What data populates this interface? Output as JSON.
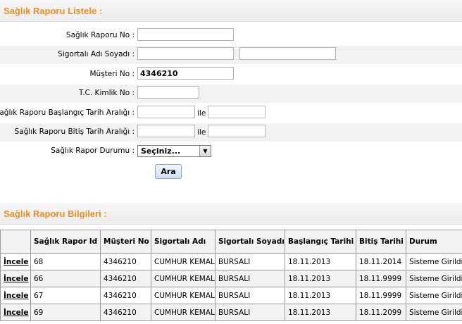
{
  "search_section": {
    "title": "Sağlık Raporu Listele :",
    "fields": {
      "report_no_label": "Sağlık Raporu No :",
      "report_no_value": "",
      "insured_name_label": "Sigortalı Adı Soyadı :",
      "insured_first_name_value": "",
      "insured_last_name_value": "",
      "customer_no_label": "Müşteri No :",
      "customer_no_value": "4346210",
      "tc_no_label": "T.C. Kimlik No :",
      "tc_no_value": "",
      "start_range_label": "Sağlık Raporu Başlangıç Tarih Aralığı :",
      "start_from_value": "",
      "start_to_value": "",
      "end_range_label": "Sağlık Raporu Bitiş Tarih Aralığı :",
      "end_from_value": "",
      "end_to_value": "",
      "range_separator": "ile",
      "status_label": "Sağlık Rapor Durumu :",
      "status_selected": "Seçiniz..."
    },
    "search_button": "Ara"
  },
  "results_section": {
    "title": "Sağlık Raporu Bilgileri :",
    "columns": [
      "",
      "Sağlık Rapor Id",
      "Müşteri No",
      "Sigortalı Adı",
      "Sigortalı Soyadı",
      "Başlangıç Tarihi",
      "Bitiş Tarihi",
      "Durum"
    ],
    "action_label": "İncele",
    "rows": [
      {
        "id": "68",
        "customer_no": "4346210",
        "first_name": "CUMHUR KEMAL",
        "last_name": "BURSALI",
        "start": "18.11.2013",
        "end": "18.11.2014",
        "status": "Sisteme Girildi"
      },
      {
        "id": "66",
        "customer_no": "4346210",
        "first_name": "CUMHUR KEMAL",
        "last_name": "BURSALI",
        "start": "18.11.2013",
        "end": "18.11.9999",
        "status": "Sisteme Girildi"
      },
      {
        "id": "67",
        "customer_no": "4346210",
        "first_name": "CUMHUR KEMAL",
        "last_name": "BURSALI",
        "start": "18.11.2013",
        "end": "18.11.9999",
        "status": "Sisteme Girildi"
      },
      {
        "id": "69",
        "customer_no": "4346210",
        "first_name": "CUMHUR KEMAL",
        "last_name": "BURSALI",
        "start": "18.11.2013",
        "end": "18.11.2099",
        "status": "Sisteme Girildi"
      }
    ]
  },
  "colors": {
    "section_title": "#f0901a",
    "row_shade": "#f2f2f2"
  }
}
